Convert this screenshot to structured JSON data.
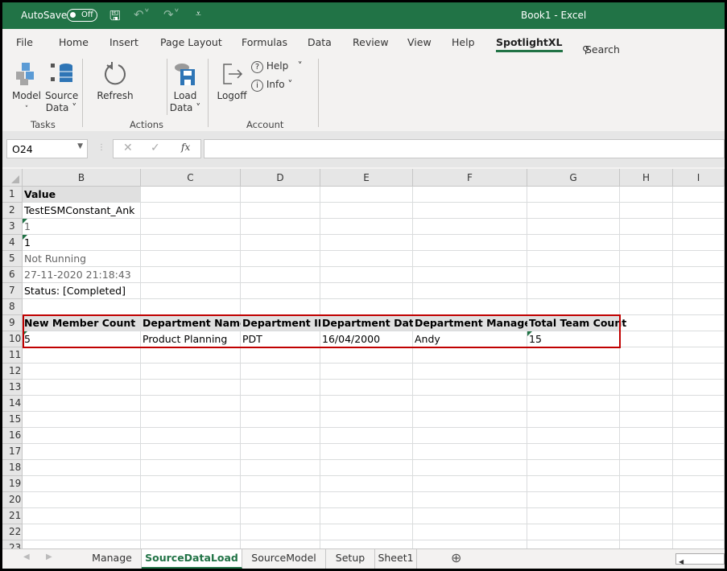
{
  "titlebar": {
    "autosave_label": "AutoSave",
    "autosave_state": "Off",
    "title": "Book1  -  Excel"
  },
  "tabs": [
    {
      "label": "File"
    },
    {
      "label": "Home"
    },
    {
      "label": "Insert"
    },
    {
      "label": "Page Layout"
    },
    {
      "label": "Formulas"
    },
    {
      "label": "Data"
    },
    {
      "label": "Review"
    },
    {
      "label": "View"
    },
    {
      "label": "Help"
    },
    {
      "label": "SpotlightXL",
      "active": true
    }
  ],
  "search_label": "Search",
  "ribbon": {
    "model": "Model",
    "source": "Source",
    "data": "Data",
    "refresh": "Refresh",
    "load": "Load",
    "logoff": "Logoff",
    "help": "Help",
    "info": "Info",
    "groups": {
      "tasks": "Tasks",
      "actions": "Actions",
      "account": "Account"
    }
  },
  "formula_bar": {
    "name_box": "O24",
    "formula": ""
  },
  "columns": [
    "B",
    "C",
    "D",
    "E",
    "F",
    "G",
    "H",
    "I"
  ],
  "row_count": 23,
  "cells": [
    {
      "r": 1,
      "c": "B",
      "v": "Value",
      "bold": true,
      "shade": true
    },
    {
      "r": 2,
      "c": "B",
      "v": "TestESMConstant_Ank"
    },
    {
      "r": 3,
      "c": "B",
      "v": "1",
      "gray": true,
      "flag": true
    },
    {
      "r": 4,
      "c": "B",
      "v": "1",
      "flag": true
    },
    {
      "r": 5,
      "c": "B",
      "v": "Not Running",
      "gray": true
    },
    {
      "r": 6,
      "c": "B",
      "v": "27-11-2020 21:18:43",
      "gray": true
    },
    {
      "r": 7,
      "c": "B",
      "v": "Status: [Completed]"
    },
    {
      "r": 9,
      "c": "B",
      "v": "New Member Count",
      "bold": true,
      "shade": true
    },
    {
      "r": 9,
      "c": "C",
      "v": "Department Name",
      "bold": true,
      "shade": true
    },
    {
      "r": 9,
      "c": "D",
      "v": "Department ID",
      "bold": true,
      "shade": true
    },
    {
      "r": 9,
      "c": "E",
      "v": "Department Date",
      "bold": true,
      "shade": true
    },
    {
      "r": 9,
      "c": "F",
      "v": "Department Manager",
      "bold": true,
      "shade": true
    },
    {
      "r": 9,
      "c": "G",
      "v": "Total Team Count",
      "bold": true,
      "shade": true
    },
    {
      "r": 10,
      "c": "B",
      "v": "5",
      "flag": true
    },
    {
      "r": 10,
      "c": "C",
      "v": "Product Planning"
    },
    {
      "r": 10,
      "c": "D",
      "v": "PDT"
    },
    {
      "r": 10,
      "c": "E",
      "v": "16/04/2000"
    },
    {
      "r": 10,
      "c": "F",
      "v": "Andy"
    },
    {
      "r": 10,
      "c": "G",
      "v": "15",
      "flag": true
    }
  ],
  "sheets": [
    {
      "label": "Manage"
    },
    {
      "label": "SourceDataLoad",
      "active": true
    },
    {
      "label": "SourceModel"
    },
    {
      "label": "Setup"
    },
    {
      "label": "Sheet1"
    }
  ],
  "colors": {
    "accent": "#217346",
    "highlight": "#c00000"
  }
}
